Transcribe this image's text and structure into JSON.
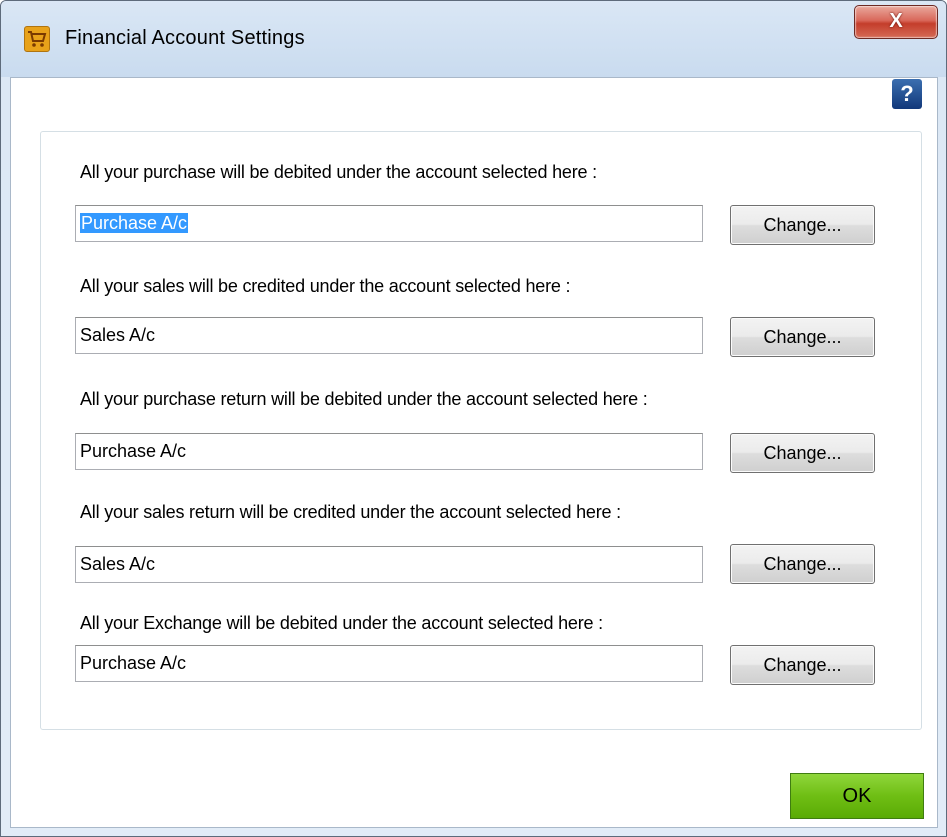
{
  "window": {
    "title": "Financial Account Settings",
    "close_label": "X",
    "help_label": "?"
  },
  "settings": [
    {
      "label": "All your purchase will be debited under the account selected here :",
      "value": "Purchase A/c",
      "selected": true,
      "button": "Change..."
    },
    {
      "label": "All your sales will be credited under the account selected here :",
      "value": "Sales A/c",
      "selected": false,
      "button": "Change..."
    },
    {
      "label": "All your purchase return will be debited under the account selected here :",
      "value": "Purchase A/c",
      "selected": false,
      "button": "Change..."
    },
    {
      "label": "All your sales return will be credited under the account selected here :",
      "value": "Sales A/c",
      "selected": false,
      "button": "Change..."
    },
    {
      "label": "All your Exchange will be debited under the account selected here :",
      "value": "Purchase A/c",
      "selected": false,
      "button": "Change..."
    }
  ],
  "footer": {
    "ok_label": "OK"
  },
  "colors": {
    "ok_button": "#6fbe14",
    "selection": "#3399ff",
    "close_button": "#c43d2b"
  }
}
